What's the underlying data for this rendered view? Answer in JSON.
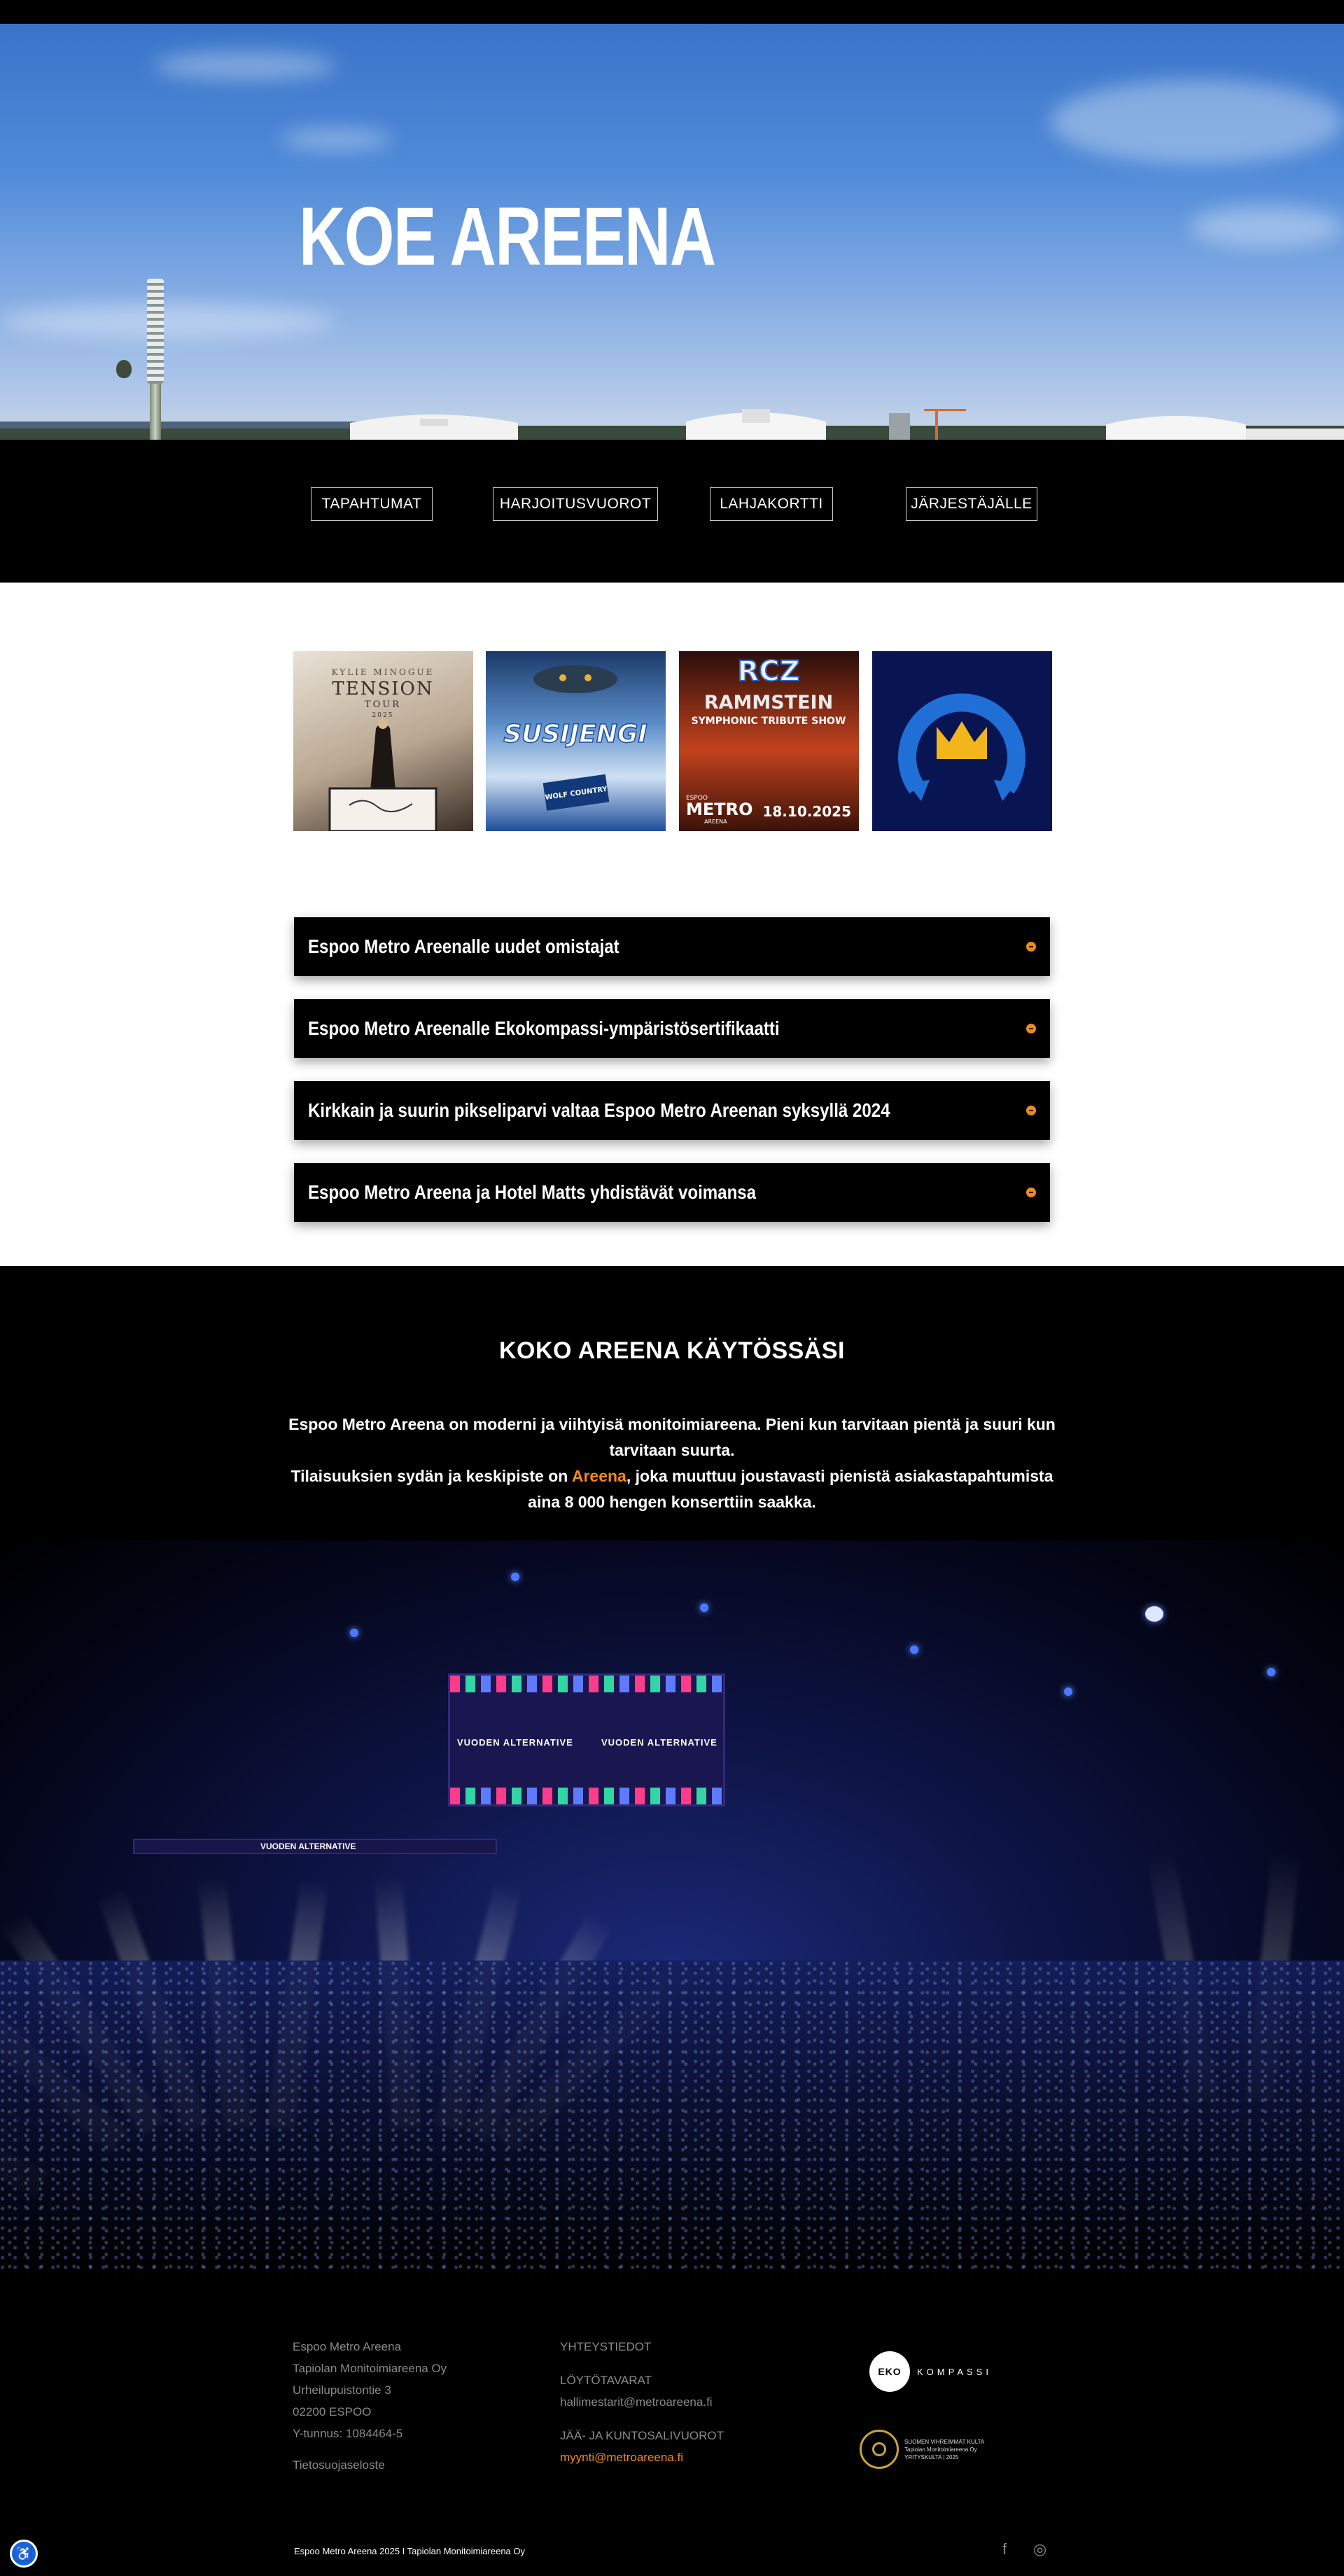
{
  "hero": {
    "title": "KOE AREENA"
  },
  "nav": {
    "items": [
      {
        "label": "TAPAHTUMAT"
      },
      {
        "label": "HARJOITUSVUOROT"
      },
      {
        "label": "LAHJAKORTTI"
      },
      {
        "label": "JÄRJESTÄJÄLLE"
      }
    ]
  },
  "events": [
    {
      "top": "KYLIE MINOGUE",
      "name": "TENSION",
      "sub": "TOUR",
      "year": "2025",
      "icon": "kylie-poster"
    },
    {
      "name": "SUSIJENGI",
      "sub": "WOLF COUNTRY",
      "icon": "susijengi-poster"
    },
    {
      "top": "RCZ",
      "name": "RAMMSTEIN",
      "sub": "SYMPHONIC TRIBUTE SHOW",
      "venue": "METRO",
      "venue_sub": "ESPOO",
      "venue_sub2": "AREENA",
      "date": "18.10.2025",
      "icon": "rammstein-poster"
    },
    {
      "icon": "metro-areena-crown-logo"
    }
  ],
  "news": [
    {
      "title": "Espoo Metro Areenalle uudet omistajat"
    },
    {
      "title": "Espoo Metro Areenalle Ekokompassi-ympäristösertifikaatti"
    },
    {
      "title": "Kirkkain ja suurin pikseliparvi valtaa Espoo Metro Areenan syksyllä 2024"
    },
    {
      "title": "Espoo Metro Areena ja Hotel Matts yhdistävät voimansa"
    }
  ],
  "info": {
    "title": "KOKO AREENA KÄYTÖSSÄSI",
    "line1": "Espoo Metro Areena on moderni ja viihtyisä monitoimiareena. Pieni kun tarvitaan pientä ja suuri kun tarvitaan suurta.",
    "line2_pre": "Tilaisuuksien sydän ja keskipiste on ",
    "line2_link": "Areena",
    "line2_post": ",  joka muuttuu joustavasti pienistä asiakastapahtumista aina 8 000  hengen konserttiin saakka."
  },
  "arena": {
    "screen_label_left": "VUODEN ALTERNATIVE",
    "screen_label_right": "VUODEN ALTERNATIVE",
    "banner_label": "VUODEN ALTERNATIVE"
  },
  "footer": {
    "address": [
      "Espoo Metro Areena",
      "Tapiolan Monitoimiareena Oy",
      "Urheilupuistontie 3",
      "02200 ESPOO",
      "Y-tunnus: 1084464-5"
    ],
    "privacy": "Tietosuojaseloste",
    "contact_heading": "YHTEYSTIEDOT",
    "lost_heading": "LÖYTÖTAVARAT",
    "lost_email": "hallimestarit@metroareena.fi",
    "ice_heading": "JÄÄ- JA KUNTOSALIVUOROT",
    "sales_email": "myynti@metroareena.fi",
    "eko_circle": "EKO",
    "eko_word": "KOMPASSI",
    "gold_line1": "SUOMEN VIHREIMMÄT KULTA",
    "gold_line2": "Tapiolan Monitoimiareena Oy",
    "gold_line3": "YRITYSKULTA | 2025",
    "copyright": "Espoo Metro Areena 2025 I Tapiolan Monitoimiareena Oy",
    "social": [
      {
        "icon": "facebook-icon",
        "glyph": "f"
      },
      {
        "icon": "instagram-icon",
        "glyph": "◎"
      }
    ],
    "a11y_glyph": "♿"
  },
  "colors": {
    "accent": "#f08a1c",
    "background": "#000000",
    "section_white": "#ffffff"
  }
}
